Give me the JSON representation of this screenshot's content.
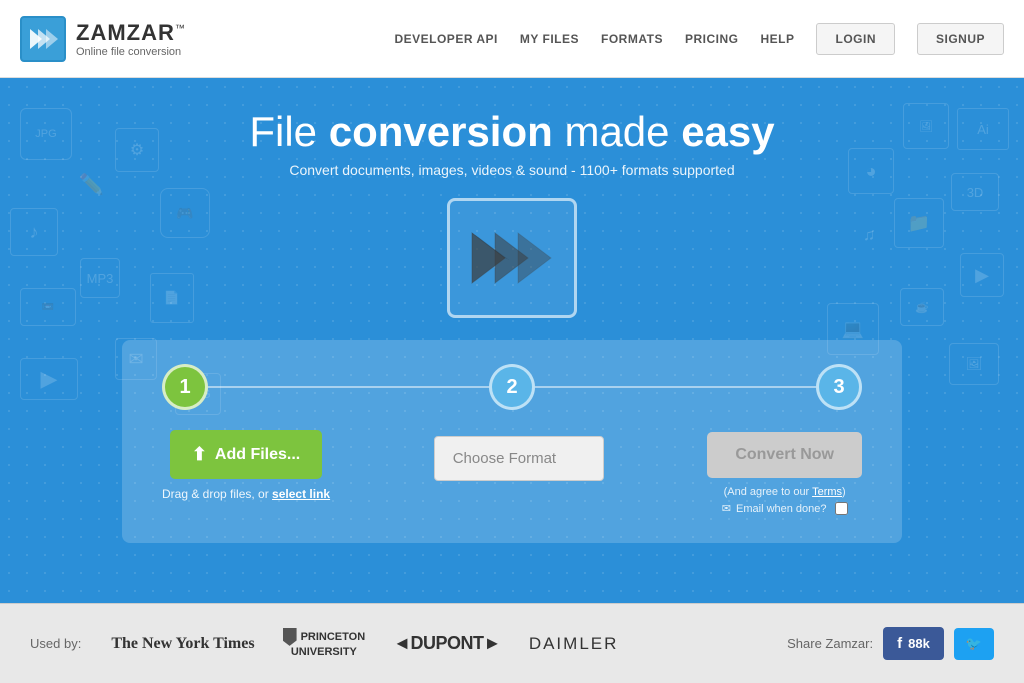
{
  "header": {
    "logo_name": "ZAMZAR",
    "logo_tm": "™",
    "logo_sub": "Online file conversion",
    "nav": {
      "developer_api": "DEVELOPER API",
      "my_files": "MY FILES",
      "formats": "FORMATS",
      "pricing": "PRICING",
      "help": "HELP",
      "login": "LOGIN",
      "signup": "SIGNUP"
    }
  },
  "hero": {
    "title_prefix": "File ",
    "title_bold": "conversion",
    "title_suffix": " made ",
    "title_bold2": "easy",
    "subtitle": "Convert documents, images, videos & sound - 1100+ formats supported"
  },
  "steps": {
    "step1_number": "1",
    "step2_number": "2",
    "step3_number": "3",
    "add_files_label": "Add Files...",
    "drag_drop_text": "Drag & drop files, or ",
    "select_link_text": "select link",
    "choose_format_placeholder": "Choose Format",
    "convert_now_label": "Convert Now",
    "agree_text": "(And agree to our ",
    "terms_text": "Terms",
    "agree_close": ")",
    "email_label": "Email when done?"
  },
  "footer": {
    "used_by": "Used by:",
    "brands": [
      {
        "name": "The New York Times",
        "style": "nyt"
      },
      {
        "name": "PRINCETON\nUNIVERSITY",
        "style": "princeton"
      },
      {
        "name": "◄DUPONT►",
        "style": "dupont"
      },
      {
        "name": "DAIMLER",
        "style": "daimler"
      }
    ],
    "share_label": "Share Zamzar:",
    "facebook_count": "88k",
    "twitter_label": "🐦"
  },
  "colors": {
    "hero_bg": "#2b8fd8",
    "step_active": "#7dc43e",
    "step_inactive": "#5ab5e8",
    "facebook": "#3b5998",
    "twitter": "#1da1f2"
  }
}
